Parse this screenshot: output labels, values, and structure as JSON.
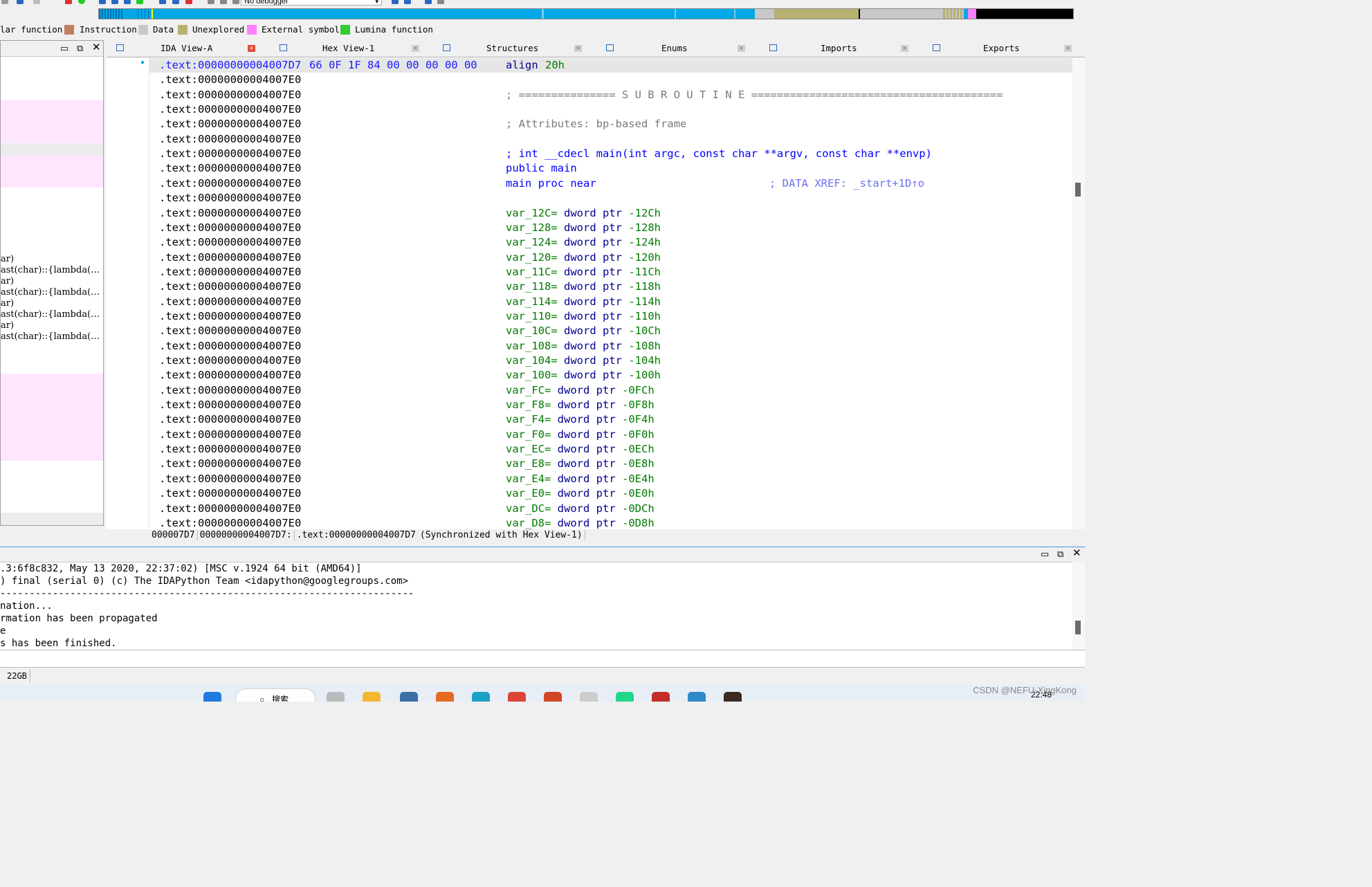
{
  "toolbar": {
    "debugger_label": "No debugger",
    "colors": {
      "nav_code": "#00a8e8",
      "nav_data": "#c8c8c8",
      "nav_unexplored": "#b8b070",
      "nav_external": "#ff80ff",
      "nav_black": "#000000"
    }
  },
  "legend": [
    {
      "label": "lar function",
      "color": ""
    },
    {
      "label": "Instruction",
      "color": "#c08060"
    },
    {
      "label": "Data",
      "color": "#c8c8c8"
    },
    {
      "label": "Unexplored",
      "color": "#b8b070"
    },
    {
      "label": "External symbol",
      "color": "#ff80ff"
    },
    {
      "label": "Lumina function",
      "color": "#33cc33"
    }
  ],
  "left_panel": {
    "functions": [
      "ar)",
      "ast(char)::{lambda(…",
      "ar)",
      "ast(char)::{lambda(…",
      "ar)",
      "ast(char)::{lambda(…",
      "ar)",
      "ast(char)::{lambda(…"
    ]
  },
  "tabs": [
    {
      "label": "IDA View-A",
      "icon": "ida-view-icon",
      "active": true
    },
    {
      "label": "Hex View-1",
      "icon": "hex-view-icon",
      "active": false
    },
    {
      "label": "Structures",
      "icon": "structures-icon",
      "active": false
    },
    {
      "label": "Enums",
      "icon": "enums-icon",
      "active": false
    },
    {
      "label": "Imports",
      "icon": "imports-icon",
      "active": false
    },
    {
      "label": "Exports",
      "icon": "exports-icon",
      "active": false
    }
  ],
  "listing": {
    "first": {
      "addr": ".text:00000000004007D7",
      "bytes": "66 0F 1F 84 00 00 00 00 00",
      "mnemonic": "align",
      "operand": "20h"
    },
    "addr": ".text:00000000004007E0",
    "lines": [
      {
        "text": ""
      },
      {
        "text": "; =============== S U B R O U T I N E =======================================",
        "cls": "cgray"
      },
      {
        "text": ""
      },
      {
        "text": "; Attributes: bp-based frame",
        "cls": "cgray"
      },
      {
        "text": ""
      },
      {
        "text": "; int __cdecl main(int argc, const char **argv, const char **envp)",
        "cls": "cblue"
      },
      {
        "text": "public main",
        "cls": "cblue"
      },
      {
        "text": "main proc near",
        "cls": "cblue",
        "xref": "; DATA XREF: _start+1D↑o"
      },
      {
        "text": ""
      },
      {
        "var": "var_12C=",
        "val": "-12Ch"
      },
      {
        "var": "var_128=",
        "val": "-128h"
      },
      {
        "var": "var_124=",
        "val": "-124h"
      },
      {
        "var": "var_120=",
        "val": "-120h"
      },
      {
        "var": "var_11C=",
        "val": "-11Ch"
      },
      {
        "var": "var_118=",
        "val": "-118h"
      },
      {
        "var": "var_114=",
        "val": "-114h"
      },
      {
        "var": "var_110=",
        "val": "-110h"
      },
      {
        "var": "var_10C=",
        "val": "-10Ch"
      },
      {
        "var": "var_108=",
        "val": "-108h"
      },
      {
        "var": "var_104=",
        "val": "-104h"
      },
      {
        "var": "var_100=",
        "val": "-100h"
      },
      {
        "var": "var_FC=",
        "val": "-0FCh"
      },
      {
        "var": "var_F8=",
        "val": "-0F8h"
      },
      {
        "var": "var_F4=",
        "val": "-0F4h"
      },
      {
        "var": "var_F0=",
        "val": "-0F0h"
      },
      {
        "var": "var_EC=",
        "val": "-0ECh"
      },
      {
        "var": "var_E8=",
        "val": "-0E8h"
      },
      {
        "var": "var_E4=",
        "val": "-0E4h"
      },
      {
        "var": "var_E0=",
        "val": "-0E0h"
      },
      {
        "var": "var_DC=",
        "val": "-0DCh"
      },
      {
        "var": "var_D8=",
        "val": "-0D8h"
      }
    ],
    "dword_ptr": "dword ptr"
  },
  "status": {
    "offset": "000007D7",
    "address": "00000000004007D7:",
    "location": ".text:00000000004007D7",
    "sync": "(Synchronized with Hex View-1)"
  },
  "output": {
    "lines": [
      ".3:6f8c832, May 13 2020, 22:37:02) [MSC v.1924 64 bit (AMD64)]",
      ") final (serial 0) (c) The IDAPython Team <idapython@googlegroups.com>",
      "-----------------------------------------------------------------------",
      "nation...",
      "rmation has been propagated",
      "e",
      "s has been finished."
    ]
  },
  "disk": "22GB",
  "taskbar": {
    "search_text": "搜索",
    "time": "22:48",
    "watermark": "CSDN @NEFU-XingKong"
  }
}
